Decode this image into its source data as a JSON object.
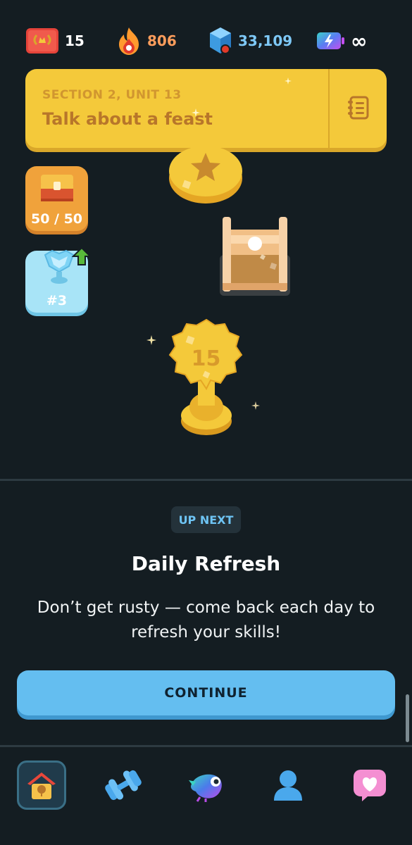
{
  "stats": {
    "crown": "15",
    "streak": "806",
    "gems": "33,109",
    "energy": "∞"
  },
  "colors": {
    "streak": "#ff9d5c",
    "gems": "#7ec8f6",
    "continue": "#64bef0",
    "banner": "#f4c93a"
  },
  "banner": {
    "section": "SECTION 2, UNIT 13",
    "title": "Talk about a feast",
    "guide_icon": "notebook-icon"
  },
  "path": {
    "chest_progress": "50 / 50",
    "league_rank": "#3",
    "current_level": "15"
  },
  "up_next": {
    "badge": "UP NEXT",
    "title": "Daily Refresh",
    "description": "Don’t get rusty — come back each day to refresh your skills!",
    "button": "CONTINUE"
  },
  "nav": {
    "items": [
      "home-icon",
      "dumbbell-icon",
      "duo-bird-icon",
      "profile-icon",
      "heart-message-icon"
    ],
    "active": "home"
  }
}
